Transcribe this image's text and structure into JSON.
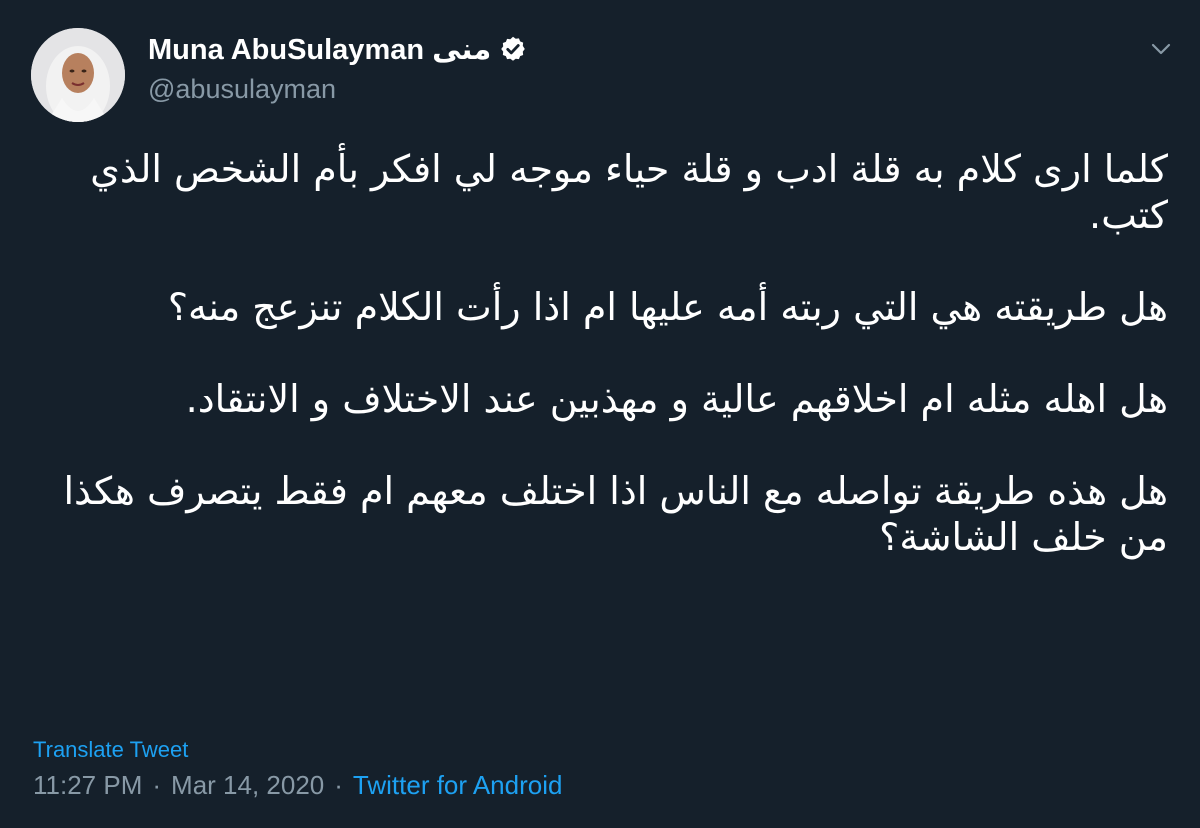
{
  "author": {
    "display_name": "Muna AbuSulayman",
    "display_name_ar": "منى",
    "handle": "@abusulayman"
  },
  "icons": {
    "verified": "verified-badge-icon",
    "more": "chevron-down-icon"
  },
  "tweet": {
    "paragraphs": [
      "كلما ارى كلام به قلة ادب و قلة حياء موجه لي  افكر بأم الشخص الذي كتب.",
      "هل طريقته هي التي ربته أمه عليها ام اذا رأت الكلام تنزعج منه؟",
      "هل اهله مثله ام اخلاقهم عالية و مهذبين عند الاختلاف و الانتقاد.",
      "هل هذه طريقة تواصله مع الناس اذا اختلف معهم ام فقط  يتصرف هكذا من خلف الشاشة؟"
    ],
    "translate_label": "Translate Tweet",
    "time": "11:27 PM",
    "separator": "·",
    "date": "Mar 14, 2020",
    "source": "Twitter for Android"
  },
  "colors": {
    "background": "#15202b",
    "text": "#ffffff",
    "secondary": "#8899a6",
    "accent": "#1da1f2"
  }
}
